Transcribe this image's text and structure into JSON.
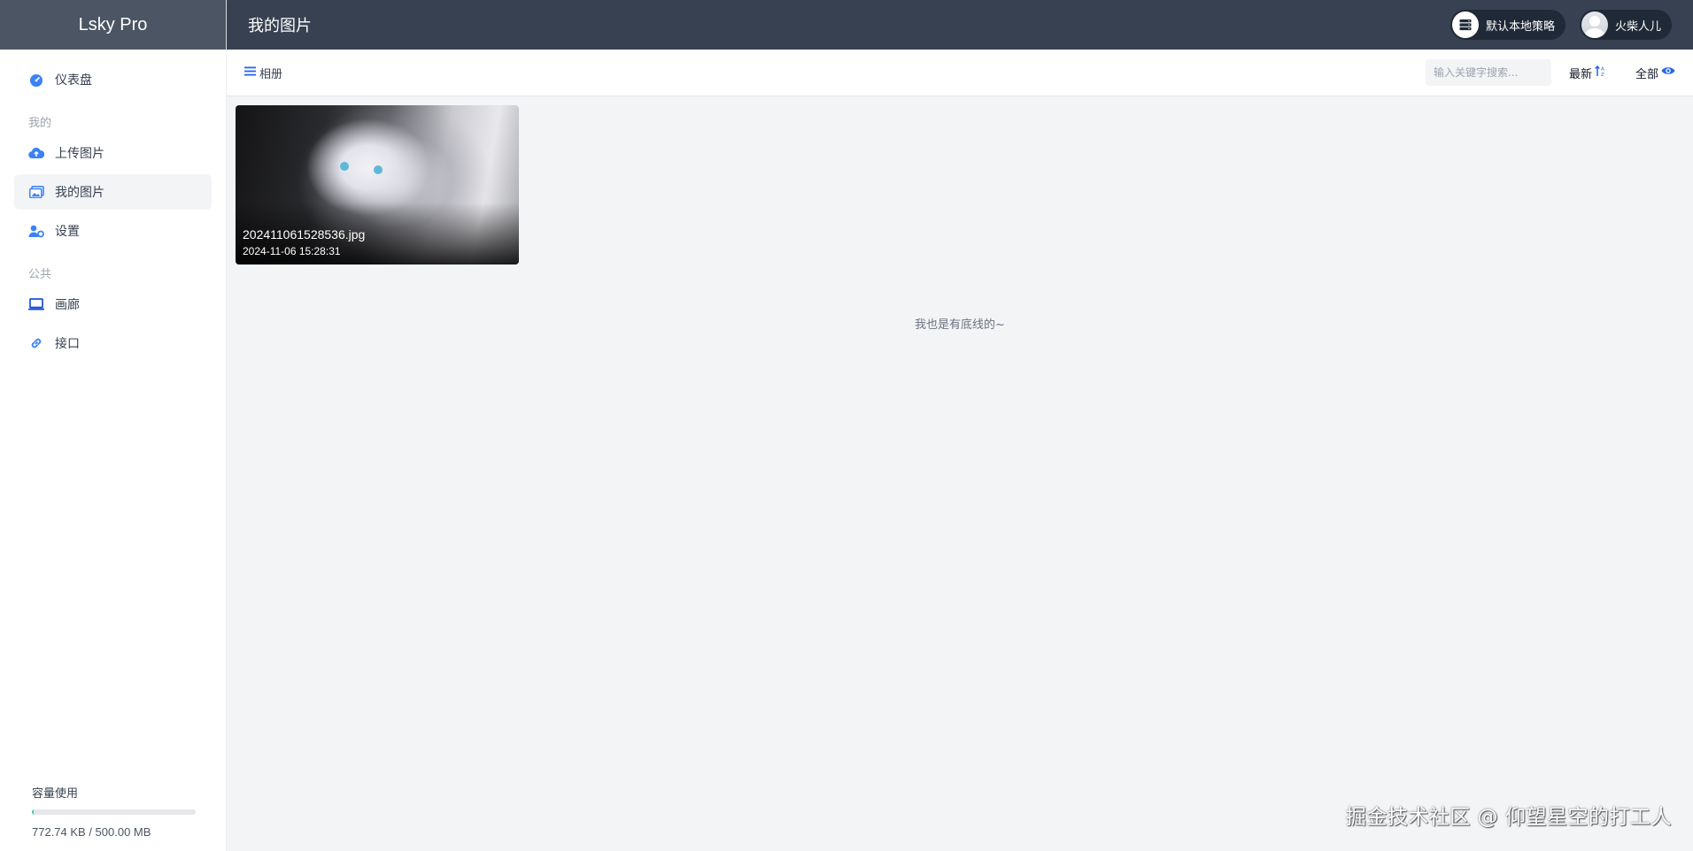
{
  "app": {
    "brand": "Lsky Pro"
  },
  "sidebar": {
    "dashboard": "仪表盘",
    "section_mine": "我的",
    "upload": "上传图片",
    "my_images": "我的图片",
    "settings": "设置",
    "section_public": "公共",
    "gallery": "画廊",
    "api": "接口"
  },
  "storage": {
    "title": "容量使用",
    "used": "772.74 KB / 500.00 MB",
    "used_fraction": 0.0015
  },
  "header": {
    "title": "我的图片",
    "strategy_label": "默认本地策略",
    "user_name": "火柴人儿"
  },
  "toolbar": {
    "album_label": "相册",
    "search_placeholder": "输入关键字搜索...",
    "sort_label": "最新",
    "filter_label": "全部"
  },
  "images": [
    {
      "name": "202411061528536.jpg",
      "date": "2024-11-06 15:28:31"
    }
  ],
  "footer": {
    "end_text": "我也是有底线的~",
    "watermark": "掘金技术社区 @ 仰望星空的打工人"
  },
  "colors": {
    "header_bg": "#374151",
    "accent": "#2563eb",
    "storage_fill": "#34d399"
  }
}
